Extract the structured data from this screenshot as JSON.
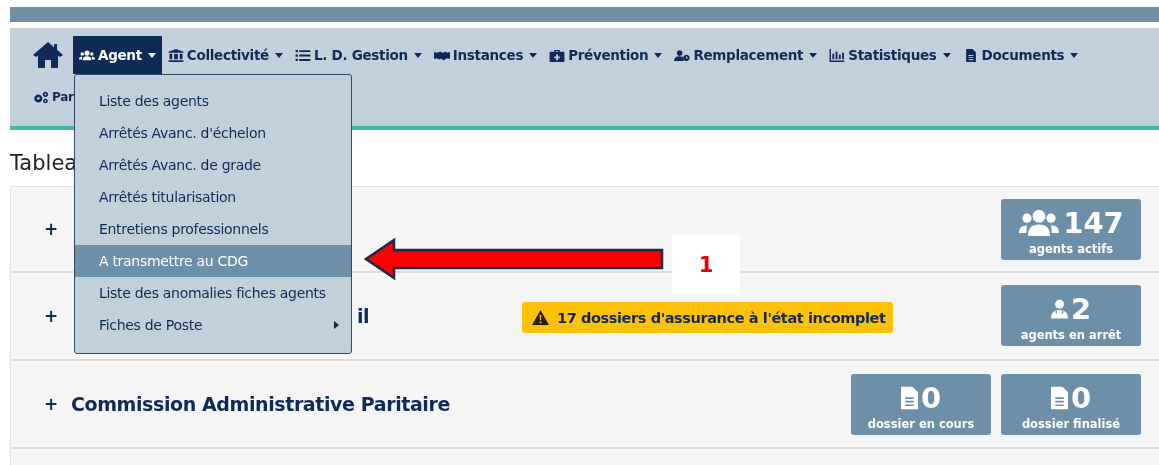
{
  "nav": {
    "items": [
      {
        "label": "Agent",
        "selected": true
      },
      {
        "label": "Collectivité",
        "selected": false
      },
      {
        "label": "L. D. Gestion",
        "selected": false
      },
      {
        "label": "Instances",
        "selected": false
      },
      {
        "label": "Prévention",
        "selected": false
      },
      {
        "label": "Remplacement",
        "selected": false
      },
      {
        "label": "Statistiques",
        "selected": false
      },
      {
        "label": "Documents",
        "selected": false
      }
    ],
    "second_row": {
      "label": "Par"
    }
  },
  "dropdown": {
    "items": [
      {
        "label": "Liste des agents",
        "selected": false,
        "submenu": false
      },
      {
        "label": "Arrêtés Avanc. d'échelon",
        "selected": false,
        "submenu": false
      },
      {
        "label": "Arrêtés Avanc. de grade",
        "selected": false,
        "submenu": false
      },
      {
        "label": "Arrêtés titularisation",
        "selected": false,
        "submenu": false
      },
      {
        "label": "Entretiens professionnels",
        "selected": false,
        "submenu": false
      },
      {
        "label": "A transmettre au CDG",
        "selected": true,
        "submenu": false
      },
      {
        "label": "Liste des anomalies fiches agents",
        "selected": false,
        "submenu": false
      },
      {
        "label": "Fiches de Poste",
        "selected": false,
        "submenu": true
      }
    ]
  },
  "page_title": "Tablea",
  "rows": [
    {
      "expander": "+",
      "stats": [
        {
          "value": "147",
          "label": "agents actifs"
        }
      ]
    },
    {
      "expander": "+",
      "title": "il",
      "alert": "17 dossiers d'assurance à l'état incomplet",
      "stats": [
        {
          "value": "2",
          "label": "agents en arrêt"
        }
      ]
    },
    {
      "expander": "+",
      "title": "Commission Administrative Paritaire",
      "stats": [
        {
          "value": "0",
          "label": "dossier en cours"
        },
        {
          "value": "0",
          "label": "dossier finalisé"
        }
      ]
    }
  ],
  "annotation": {
    "number": "1"
  }
}
